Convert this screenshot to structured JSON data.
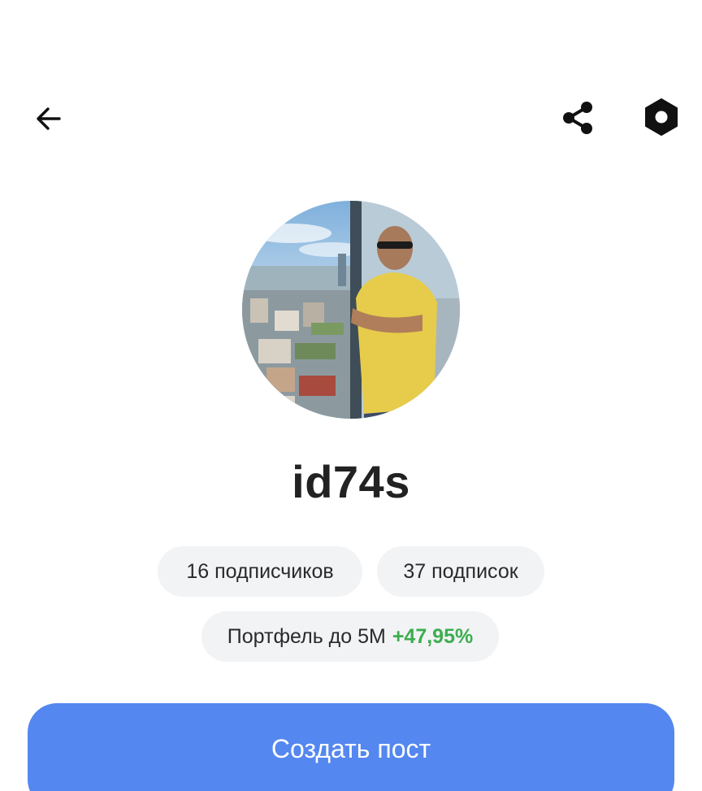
{
  "header": {
    "back_icon": "arrow-left-icon",
    "share_icon": "share-icon",
    "settings_icon": "settings-nut-icon"
  },
  "profile": {
    "username": "id74s",
    "followers_label": "16 подписчиков",
    "following_label": "37 подписок",
    "portfolio_label": "Портфель до 5М",
    "portfolio_gain": "+47,95%"
  },
  "actions": {
    "create_post_label": "Создать пост"
  },
  "colors": {
    "accent_button": "#5487ef",
    "gain_green": "#3cae4e",
    "chip_background": "#f2f3f5"
  }
}
